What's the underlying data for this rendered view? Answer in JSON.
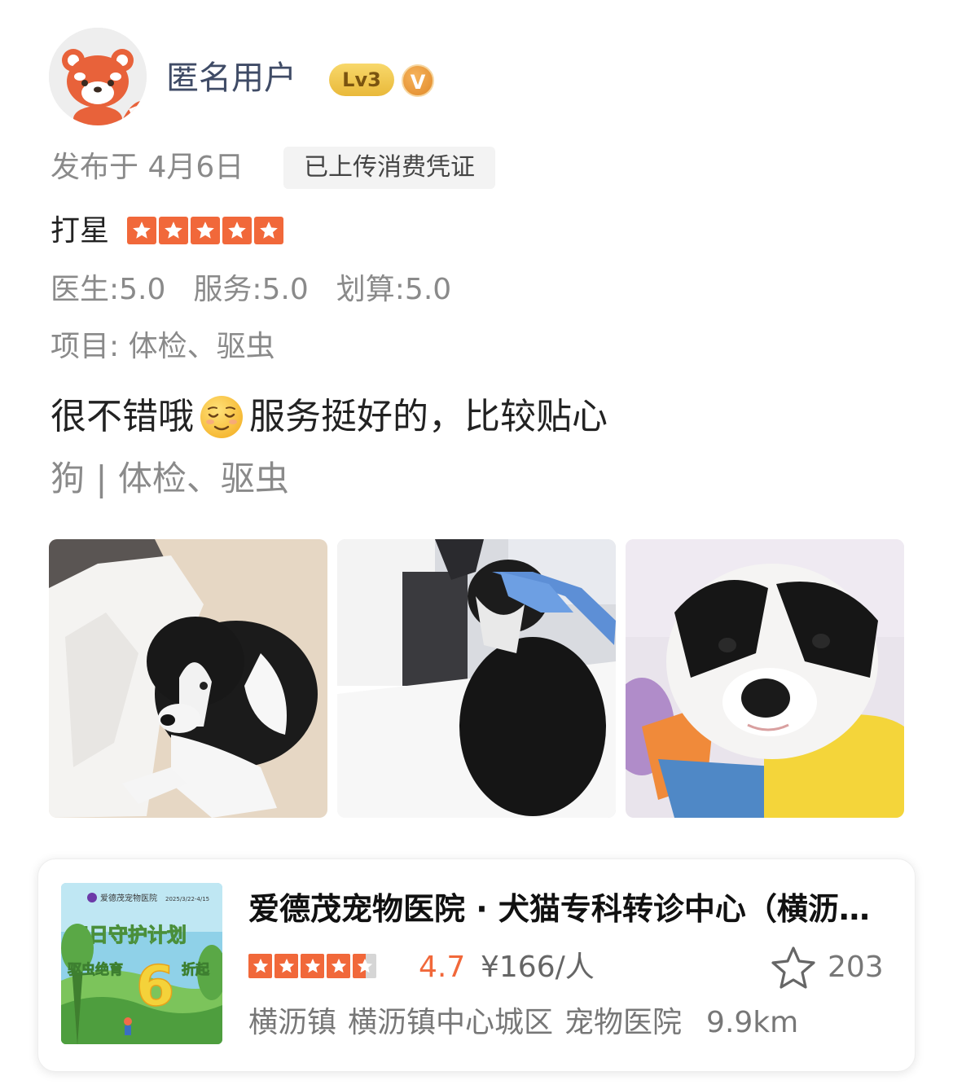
{
  "user": {
    "name": "匿名用户",
    "level": "Lv3",
    "verified_badge": "V",
    "avatar_icon": "red-panda-avatar"
  },
  "meta": {
    "publish": "发布于 4月6日",
    "voucher_tag": "已上传消费凭证"
  },
  "rating": {
    "label": "打星",
    "stars": 5,
    "max_stars": 5
  },
  "scores": {
    "doctor": "医生:5.0",
    "service": "服务:5.0",
    "value": "划算:5.0"
  },
  "items": "项目:  体检、驱虫",
  "review": {
    "text_before": "很不错哦",
    "emoji": "relieved-face-emoji",
    "text_after": "服务挺好的，比较贴心"
  },
  "tags": "狗 | 体检、驱虫",
  "photos": [
    {
      "name": "photo-puppy-lying"
    },
    {
      "name": "photo-puppy-exam"
    },
    {
      "name": "photo-puppy-closeup"
    }
  ],
  "shop": {
    "name": "爱德茂宠物医院 · 犬猫专科转诊中心（横沥店）",
    "stars": 4.5,
    "rating": "4.7",
    "price": "¥166/人",
    "fav_count": "203",
    "area": "横沥镇",
    "district": "横沥镇中心城区",
    "category": "宠物医院",
    "distance": "9.9km",
    "thumb": {
      "brand": "爱德茂宠物医院",
      "date": "2025/3/22-4/15",
      "headline": "春日守护计划",
      "promo_left": "驱虫绝育",
      "promo_num": "6",
      "promo_right": "折起"
    }
  },
  "colors": {
    "accent": "#f1683a",
    "username": "#3f4b66",
    "muted": "#8a8a8a"
  }
}
